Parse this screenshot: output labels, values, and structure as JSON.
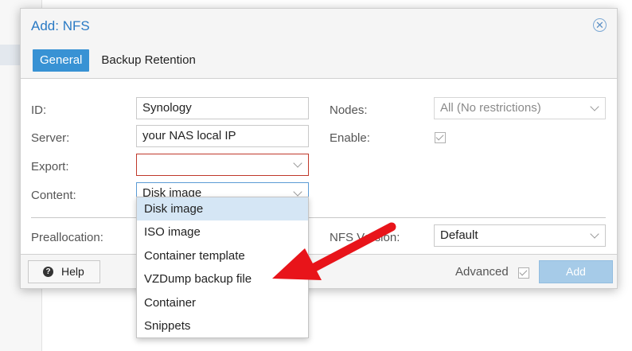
{
  "dialog": {
    "title": "Add: NFS",
    "close_icon": "close-circle-icon"
  },
  "tabs": [
    {
      "label": "General",
      "active": true
    },
    {
      "label": "Backup Retention",
      "active": false
    }
  ],
  "form": {
    "id": {
      "label": "ID:",
      "value": "Synology"
    },
    "server": {
      "label": "Server:",
      "value": "your NAS local IP"
    },
    "export": {
      "label": "Export:",
      "value": "",
      "invalid": true
    },
    "content": {
      "label": "Content:",
      "value": "Disk image"
    },
    "preallocation": {
      "label": "Preallocation:"
    },
    "nodes": {
      "label": "Nodes:",
      "value": "All (No restrictions)"
    },
    "enable": {
      "label": "Enable:",
      "checked": true
    },
    "nfs_version": {
      "label": "NFS Version:",
      "value": "Default"
    }
  },
  "content_dropdown": {
    "options": [
      "Disk image",
      "ISO image",
      "Container template",
      "VZDump backup file",
      "Container",
      "Snippets"
    ],
    "selected": "Disk image"
  },
  "footer": {
    "help_label": "Help",
    "help_icon": "question-circle-icon",
    "advanced_label": "Advanced",
    "advanced_checked": true,
    "add_label": "Add"
  },
  "annotation": {
    "arrow_color": "#e8141a",
    "points_to": "VZDump backup file"
  },
  "colors": {
    "accent": "#3892d4",
    "title": "#2a7ac4",
    "error_border": "#c0392b",
    "selected_option": "#d5e6f5",
    "disabled_button": "#a6cbe8"
  }
}
